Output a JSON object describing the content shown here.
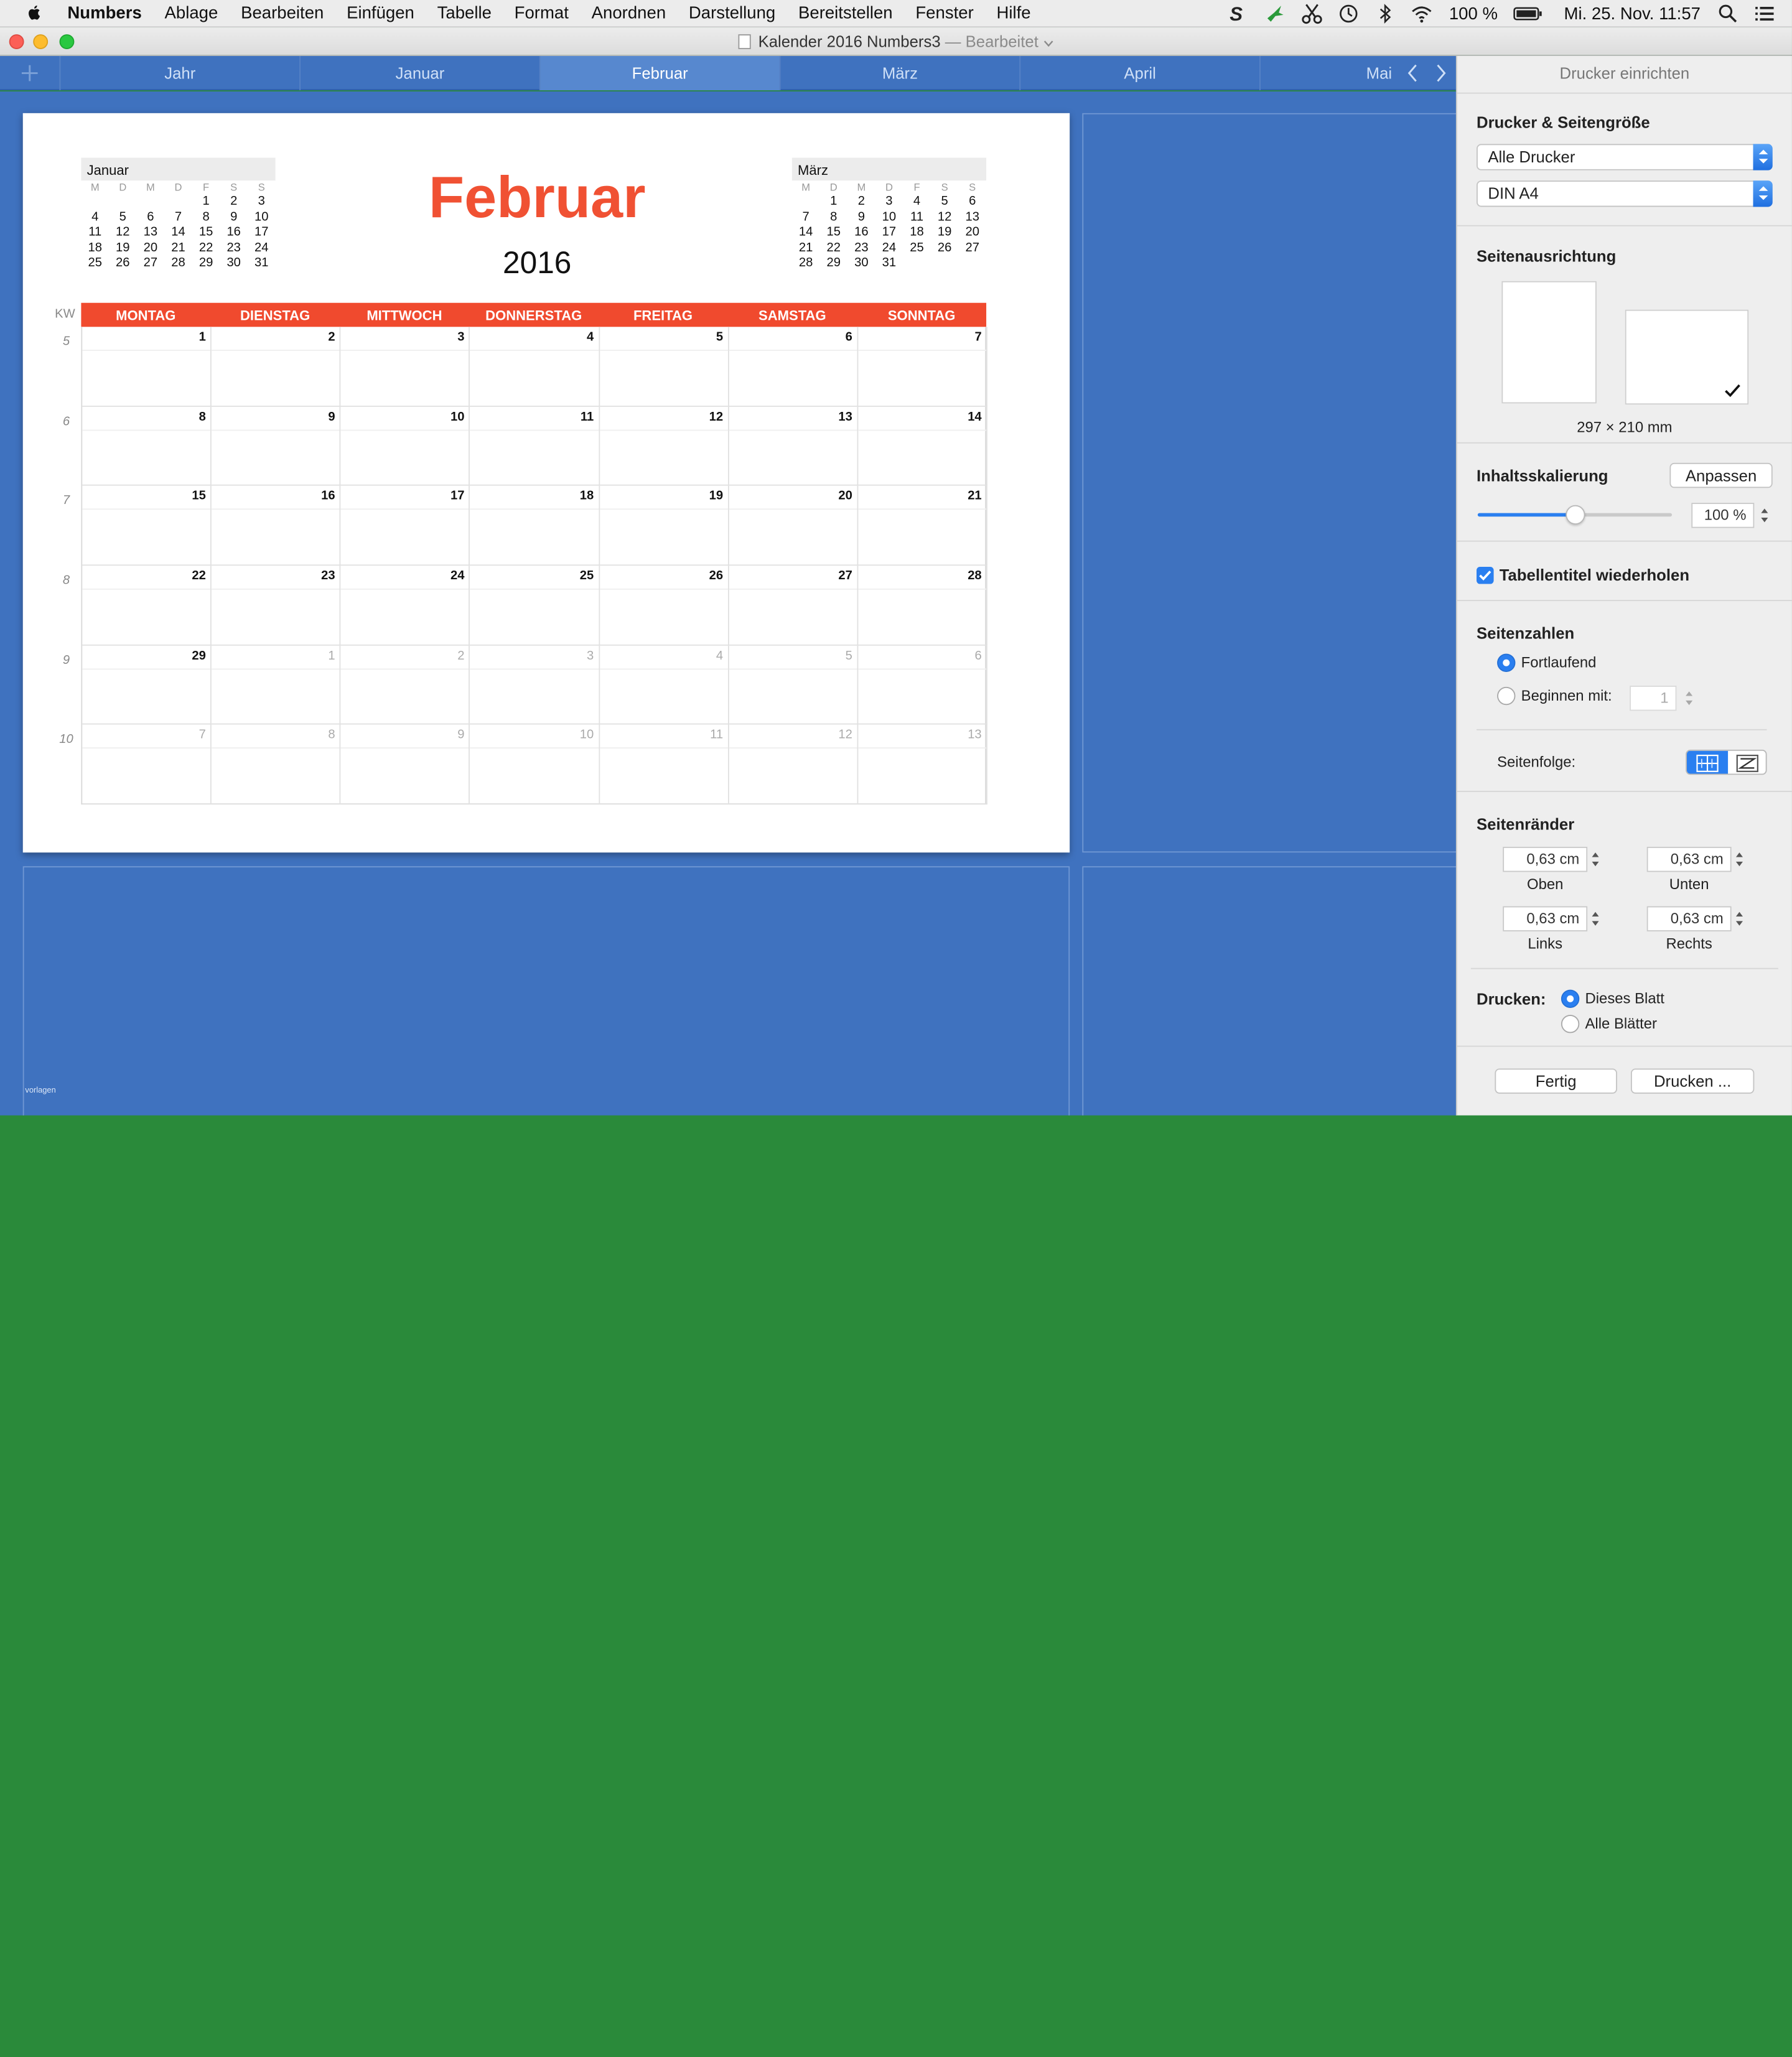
{
  "menubar": {
    "app": "Numbers",
    "items": [
      "Ablage",
      "Bearbeiten",
      "Einfügen",
      "Tabelle",
      "Format",
      "Anordnen",
      "Darstellung",
      "Bereitstellen",
      "Fenster",
      "Hilfe"
    ],
    "battery": "100 %",
    "datetime": "Mi. 25. Nov.  11:57",
    "status_icons": [
      "sync-icon",
      "hummingbird-icon",
      "scissors-icon",
      "time-machine-icon",
      "bluetooth-icon",
      "wifi-icon",
      "battery-icon",
      "search-icon",
      "list-icon"
    ]
  },
  "window": {
    "title": "Kalender 2016 Numbers3",
    "edited": "— Bearbeitet"
  },
  "tabs": [
    "Jahr",
    "Januar",
    "Februar",
    "März",
    "April",
    "Mai"
  ],
  "active_tab": 2,
  "calendar": {
    "month": "Februar",
    "year": "2016",
    "kw_label": "KW",
    "weekdays": [
      "MONTAG",
      "DIENSTAG",
      "MITTWOCH",
      "DONNERSTAG",
      "FREITAG",
      "SAMSTAG",
      "SONNTAG"
    ],
    "weeks": [
      {
        "kw": "5",
        "days": [
          "1",
          "2",
          "3",
          "4",
          "5",
          "6",
          "7"
        ],
        "dim": [
          false,
          false,
          false,
          false,
          false,
          false,
          false
        ]
      },
      {
        "kw": "6",
        "days": [
          "8",
          "9",
          "10",
          "11",
          "12",
          "13",
          "14"
        ],
        "dim": [
          false,
          false,
          false,
          false,
          false,
          false,
          false
        ]
      },
      {
        "kw": "7",
        "days": [
          "15",
          "16",
          "17",
          "18",
          "19",
          "20",
          "21"
        ],
        "dim": [
          false,
          false,
          false,
          false,
          false,
          false,
          false
        ]
      },
      {
        "kw": "8",
        "days": [
          "22",
          "23",
          "24",
          "25",
          "26",
          "27",
          "28"
        ],
        "dim": [
          false,
          false,
          false,
          false,
          false,
          false,
          false
        ]
      },
      {
        "kw": "9",
        "days": [
          "29",
          "1",
          "2",
          "3",
          "4",
          "5",
          "6"
        ],
        "dim": [
          false,
          true,
          true,
          true,
          true,
          true,
          true
        ]
      },
      {
        "kw": "10",
        "days": [
          "7",
          "8",
          "9",
          "10",
          "11",
          "12",
          "13"
        ],
        "dim": [
          true,
          true,
          true,
          true,
          true,
          true,
          true
        ]
      }
    ],
    "mini_prev": {
      "name": "Januar",
      "daynames": [
        "M",
        "D",
        "M",
        "D",
        "F",
        "S",
        "S"
      ],
      "rows": [
        [
          "",
          "",
          "",
          "",
          "1",
          "2",
          "3"
        ],
        [
          "4",
          "5",
          "6",
          "7",
          "8",
          "9",
          "10"
        ],
        [
          "11",
          "12",
          "13",
          "14",
          "15",
          "16",
          "17"
        ],
        [
          "18",
          "19",
          "20",
          "21",
          "22",
          "23",
          "24"
        ],
        [
          "25",
          "26",
          "27",
          "28",
          "29",
          "30",
          "31"
        ]
      ]
    },
    "mini_next": {
      "name": "März",
      "daynames": [
        "M",
        "D",
        "M",
        "D",
        "F",
        "S",
        "S"
      ],
      "rows": [
        [
          "",
          "1",
          "2",
          "3",
          "4",
          "5",
          "6"
        ],
        [
          "7",
          "8",
          "9",
          "10",
          "11",
          "12",
          "13"
        ],
        [
          "14",
          "15",
          "16",
          "17",
          "18",
          "19",
          "20"
        ],
        [
          "21",
          "22",
          "23",
          "24",
          "25",
          "26",
          "27"
        ],
        [
          "28",
          "29",
          "30",
          "31",
          "",
          "",
          ""
        ]
      ]
    },
    "footer": "vorlagen"
  },
  "inspector": {
    "title": "Drucker einrichten",
    "printer_section": "Drucker & Seitengröße",
    "printer": "Alle Drucker",
    "paper": "DIN A4",
    "orientation_section": "Seitenausrichtung",
    "paper_size": "297 × 210 mm",
    "scaling_label": "Inhaltsskalierung",
    "fit_button": "Anpassen",
    "scale_value": "100 %",
    "scale_fraction": 0.5,
    "repeat_titles": "Tabellentitel wiederholen",
    "page_numbers_section": "Seitenzahlen",
    "continuous": "Fortlaufend",
    "start_with": "Beginnen mit:",
    "start_value": "1",
    "page_order": "Seitenfolge:",
    "margins_section": "Seitenränder",
    "margins": [
      {
        "value": "0,63 cm",
        "label": "Oben"
      },
      {
        "value": "0,63 cm",
        "label": "Unten"
      },
      {
        "value": "0,63 cm",
        "label": "Links"
      },
      {
        "value": "0,63 cm",
        "label": "Rechts"
      }
    ],
    "print_label": "Drucken:",
    "this_sheet": "Dieses Blatt",
    "all_sheets": "Alle Blätter",
    "done_button": "Fertig",
    "print_button": "Drucken ..."
  },
  "colors": {
    "accent_red": "#f04a2e",
    "canvas_blue": "#3f72bf",
    "selection_blue": "#2a7ff0"
  }
}
